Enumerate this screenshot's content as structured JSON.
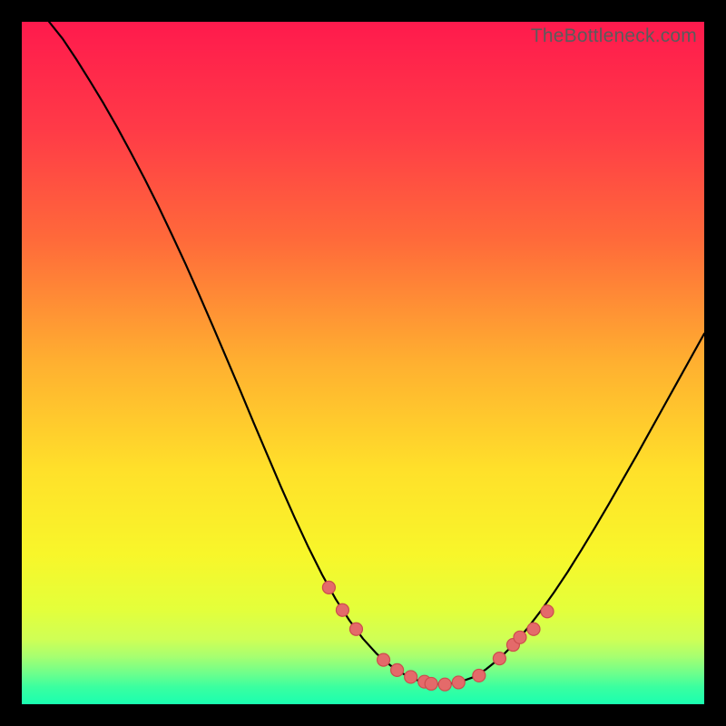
{
  "watermark": "TheBottleneck.com",
  "gradient_stops": [
    {
      "offset": 0.0,
      "color": "#ff1a4d"
    },
    {
      "offset": 0.16,
      "color": "#ff3b47"
    },
    {
      "offset": 0.32,
      "color": "#ff6a3a"
    },
    {
      "offset": 0.5,
      "color": "#ffb030"
    },
    {
      "offset": 0.66,
      "color": "#ffe12a"
    },
    {
      "offset": 0.78,
      "color": "#f8f62a"
    },
    {
      "offset": 0.86,
      "color": "#e4ff3a"
    },
    {
      "offset": 0.905,
      "color": "#cfff55"
    },
    {
      "offset": 0.93,
      "color": "#a7ff70"
    },
    {
      "offset": 0.955,
      "color": "#6dff8c"
    },
    {
      "offset": 0.975,
      "color": "#3affa0"
    },
    {
      "offset": 1.0,
      "color": "#1affb0"
    }
  ],
  "curve_style": {
    "stroke": "#000000",
    "width": 2.2
  },
  "marker_style": {
    "fill": "#e46a6a",
    "stroke": "#cc4d4d",
    "stroke_width": 1.2,
    "radius": 7
  },
  "chart_data": {
    "type": "line",
    "title": "",
    "xlabel": "",
    "ylabel": "",
    "xlim": [
      0,
      100
    ],
    "ylim": [
      0,
      100
    ],
    "curve": {
      "x": [
        4,
        6,
        8,
        10,
        12,
        14,
        16,
        18,
        20,
        22,
        24,
        26,
        28,
        30,
        32,
        34,
        36,
        38,
        40,
        42,
        44,
        46,
        48,
        50,
        52,
        54,
        56,
        58,
        60,
        62,
        64,
        66,
        68,
        70,
        72,
        74,
        76,
        78,
        80,
        82,
        84,
        86,
        88,
        90,
        92,
        94,
        96,
        98,
        100
      ],
      "y": [
        100,
        97.5,
        94.5,
        91.3,
        88,
        84.5,
        80.8,
        77,
        73,
        68.8,
        64.5,
        60,
        55.4,
        50.7,
        46,
        41.2,
        36.5,
        31.8,
        27.3,
        23,
        19,
        15.4,
        12.3,
        9.6,
        7.4,
        5.7,
        4.4,
        3.5,
        3,
        2.9,
        3.2,
        3.9,
        5.1,
        6.7,
        8.7,
        11,
        13.6,
        16.4,
        19.4,
        22.6,
        25.9,
        29.3,
        32.8,
        36.3,
        39.9,
        43.5,
        47.1,
        50.7,
        54.3
      ]
    },
    "markers": {
      "x": [
        45,
        47,
        49,
        53,
        55,
        57,
        59,
        60,
        62,
        64,
        67,
        70,
        72,
        73,
        75,
        77
      ],
      "y": [
        17.1,
        13.8,
        11,
        6.5,
        5,
        4,
        3.3,
        3,
        2.9,
        3.2,
        4.2,
        6.7,
        8.7,
        9.8,
        11,
        13.6
      ]
    }
  }
}
